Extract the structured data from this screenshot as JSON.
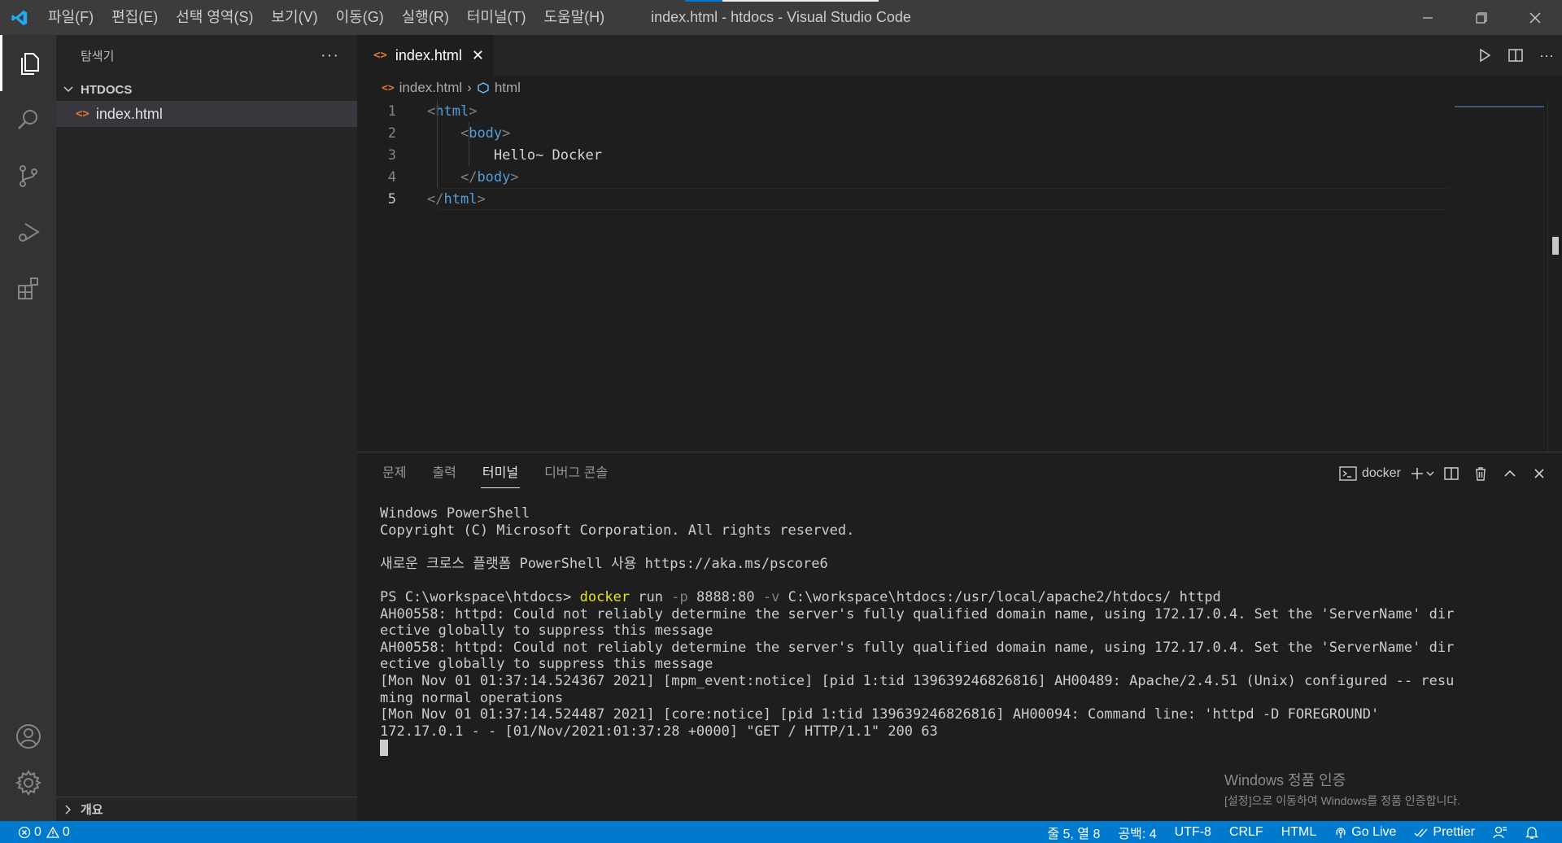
{
  "titlebar": {
    "menu": [
      "파일(F)",
      "편집(E)",
      "선택 영역(S)",
      "보기(V)",
      "이동(G)",
      "실행(R)",
      "터미널(T)",
      "도움말(H)"
    ],
    "window_title": "index.html - htdocs - Visual Studio Code"
  },
  "activitybar": {
    "items": [
      "explorer-icon",
      "search-icon",
      "source-control-icon",
      "run-debug-icon",
      "extensions-icon"
    ],
    "bottom": [
      "account-icon",
      "settings-gear-icon"
    ]
  },
  "sidebar": {
    "title": "탐색기",
    "more": "···",
    "folder": "HTDOCS",
    "file": "index.html",
    "outline": "개요"
  },
  "editor": {
    "tab_label": "index.html",
    "breadcrumb": {
      "file": "index.html",
      "symbol": "html"
    },
    "lines": [
      {
        "num": "1",
        "indent": "",
        "open": "<",
        "tag": "html",
        "close": ">",
        "text": ""
      },
      {
        "num": "2",
        "indent": "    ",
        "open": "<",
        "tag": "body",
        "close": ">",
        "text": ""
      },
      {
        "num": "3",
        "indent": "        ",
        "open": "",
        "tag": "",
        "close": "",
        "text": "Hello~ Docker"
      },
      {
        "num": "4",
        "indent": "    ",
        "open": "</",
        "tag": "body",
        "close": ">",
        "text": ""
      },
      {
        "num": "5",
        "indent": "",
        "open": "</",
        "tag": "html",
        "close": ">",
        "text": ""
      }
    ]
  },
  "panel": {
    "tabs": [
      "문제",
      "출력",
      "터미널",
      "디버그 콘솔"
    ],
    "active_tab": "터미널",
    "terminal_name": "docker",
    "terminal": {
      "l1": "Windows PowerShell",
      "l2": "Copyright (C) Microsoft Corporation. All rights reserved.",
      "l3": "",
      "l4": "새로운 크로스 플랫폼 PowerShell 사용 https://aka.ms/pscore6",
      "l5": "",
      "prompt": "PS C:\\workspace\\htdocs> ",
      "cmd": "docker",
      "arg1": " run ",
      "flag1": "-p",
      "arg2": " 8888:80 ",
      "flag2": "-v",
      "arg3": " C:\\workspace\\htdocs:/usr/local/apache2/htdocs/ httpd",
      "l7": "AH00558: httpd: Could not reliably determine the server's fully qualified domain name, using 172.17.0.4. Set the 'ServerName' dir",
      "l8": "ective globally to suppress this message",
      "l9": "AH00558: httpd: Could not reliably determine the server's fully qualified domain name, using 172.17.0.4. Set the 'ServerName' dir",
      "l10": "ective globally to suppress this message",
      "l11": "[Mon Nov 01 01:37:14.524367 2021] [mpm_event:notice] [pid 1:tid 139639246826816] AH00489: Apache/2.4.51 (Unix) configured -- resu",
      "l12": "ming normal operations",
      "l13": "[Mon Nov 01 01:37:14.524487 2021] [core:notice] [pid 1:tid 139639246826816] AH00094: Command line: 'httpd -D FOREGROUND'",
      "l14": "172.17.0.1 - - [01/Nov/2021:01:37:28 +0000] \"GET / HTTP/1.1\" 200 63"
    }
  },
  "watermark": {
    "title": "Windows 정품 인증",
    "sub": "[설정]으로 이동하여 Windows를 정품 인증합니다."
  },
  "statusbar": {
    "errors": "0",
    "warnings": "0",
    "position": "줄 5, 열 8",
    "spaces": "공백: 4",
    "encoding": "UTF-8",
    "eol": "CRLF",
    "language": "HTML",
    "golive": "Go Live",
    "prettier": "Prettier"
  },
  "colors": {
    "accent": "#007acc",
    "tag": "#569cd6",
    "bracket": "#808080",
    "command": "#e5e510"
  }
}
